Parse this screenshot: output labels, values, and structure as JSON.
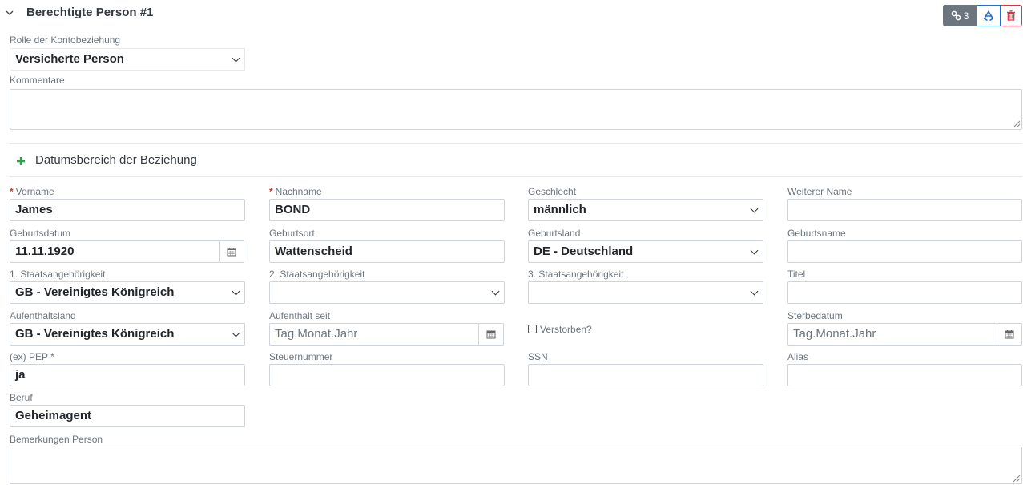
{
  "section": {
    "title": "Berechtigte Person #1"
  },
  "toolbar": {
    "link_count": "3",
    "accent": "#6c757d",
    "recycle_color": "#1f6fd1",
    "delete_color": "#dc3545"
  },
  "rolle": {
    "label": "Rolle der Kontobeziehung",
    "value": "Versicherte Person"
  },
  "kommentare": {
    "label": "Kommentare"
  },
  "datumsbereich": {
    "label": "Datumsbereich der Beziehung",
    "plus_color": "#28a745"
  },
  "fields": {
    "vorname": {
      "label": "Vorname",
      "required_mark": "*",
      "value": "James"
    },
    "nachname": {
      "label": "Nachname",
      "required_mark": "*",
      "value": "BOND"
    },
    "geschlecht": {
      "label": "Geschlecht",
      "value": "männlich"
    },
    "weiterer_name": {
      "label": "Weiterer Name",
      "value": ""
    },
    "geburtsdatum": {
      "label": "Geburtsdatum",
      "value": "11.11.1920"
    },
    "geburtsort": {
      "label": "Geburtsort",
      "value": "Wattenscheid"
    },
    "geburtsland": {
      "label": "Geburtsland",
      "value": "DE - Deutschland"
    },
    "geburtsname": {
      "label": "Geburtsname",
      "value": ""
    },
    "staat1": {
      "label": "1. Staatsangehörigkeit",
      "value": "GB - Vereinigtes Königreich"
    },
    "staat2": {
      "label": "2. Staatsangehörigkeit",
      "value": ""
    },
    "staat3": {
      "label": "3. Staatsangehörigkeit",
      "value": ""
    },
    "titel": {
      "label": "Titel",
      "value": ""
    },
    "aufenthaltsland": {
      "label": "Aufenthaltsland",
      "value": "GB - Vereinigtes Königreich"
    },
    "aufenthalt_seit": {
      "label": "Aufenthalt seit",
      "placeholder": "Tag.Monat.Jahr"
    },
    "verstorben": {
      "label": "Verstorben?"
    },
    "sterbedatum": {
      "label": "Sterbedatum",
      "placeholder": "Tag.Monat.Jahr"
    },
    "pep": {
      "label": "(ex) PEP *",
      "value": "ja"
    },
    "steuernummer": {
      "label": "Steuernummer",
      "value": ""
    },
    "ssn": {
      "label": "SSN",
      "value": ""
    },
    "alias": {
      "label": "Alias",
      "value": ""
    },
    "beruf": {
      "label": "Beruf",
      "value": "Geheimagent"
    },
    "bemerkungen": {
      "label": "Bemerkungen Person"
    }
  }
}
